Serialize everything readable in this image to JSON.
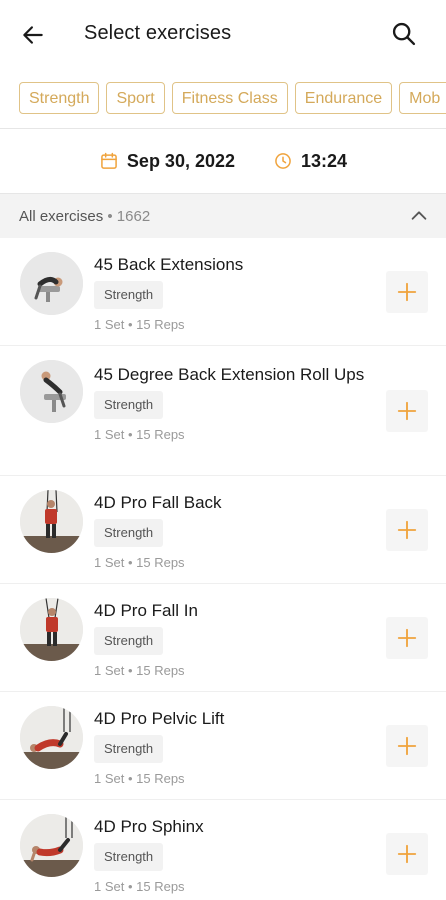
{
  "header": {
    "title": "Select exercises",
    "back_icon": "arrow-left-icon",
    "search_icon": "search-icon"
  },
  "chips": [
    "Strength",
    "Sport",
    "Fitness Class",
    "Endurance",
    "Mob"
  ],
  "datetime": {
    "date": "Sep 30, 2022",
    "time": "13:24",
    "date_icon": "calendar-icon",
    "time_icon": "clock-icon"
  },
  "section": {
    "title": "All exercises",
    "separator": " • ",
    "count": "1662",
    "collapse_icon": "chevron-up-icon"
  },
  "exercises": [
    {
      "name": "45 Back Extensions",
      "tag": "Strength",
      "meta": "1 Set • 15 Reps"
    },
    {
      "name": "45 Degree Back Extension Roll Ups",
      "tag": "Strength",
      "meta": "1 Set • 15 Reps"
    },
    {
      "name": "4D Pro Fall Back",
      "tag": "Strength",
      "meta": "1 Set • 15 Reps"
    },
    {
      "name": "4D Pro Fall In",
      "tag": "Strength",
      "meta": "1 Set • 15 Reps"
    },
    {
      "name": "4D Pro Pelvic Lift",
      "tag": "Strength",
      "meta": "1 Set • 15 Reps"
    },
    {
      "name": "4D Pro Sphinx",
      "tag": "Strength",
      "meta": "1 Set • 15 Reps"
    }
  ],
  "colors": {
    "accent": "#f0a33c",
    "chip_border": "#e0c387",
    "chip_text": "#d4a95a"
  }
}
